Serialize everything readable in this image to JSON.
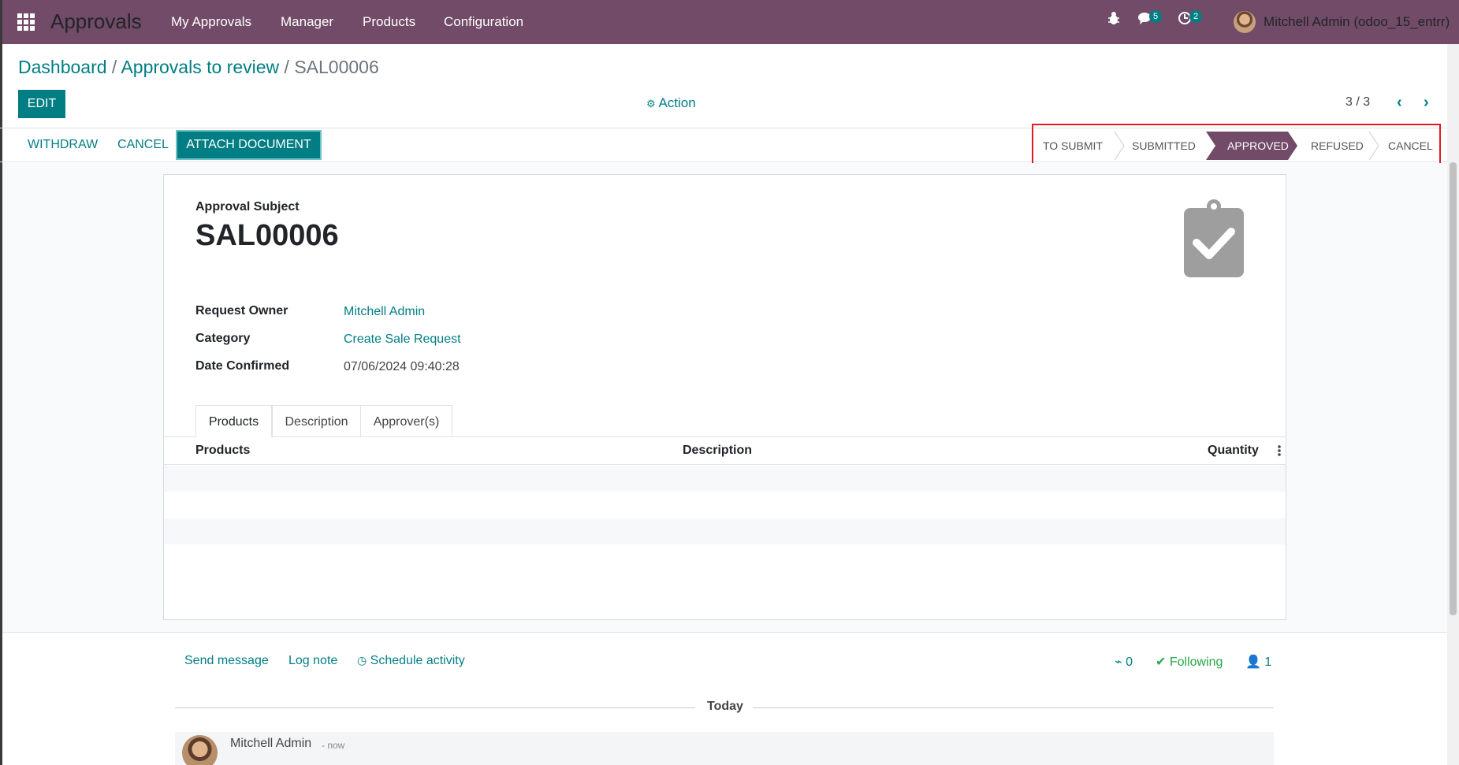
{
  "topbar": {
    "app_name": "Approvals",
    "menu": [
      "My Approvals",
      "Manager",
      "Products",
      "Configuration"
    ],
    "messages_count": "5",
    "activities_count": "2",
    "user": "Mitchell Admin (odoo_15_entrr)"
  },
  "breadcrumb": {
    "dashboard": "Dashboard",
    "sep1": " / ",
    "review": "Approvals to review",
    "sep2": " / ",
    "current": "SAL00006"
  },
  "control": {
    "edit": "EDIT",
    "action": "Action",
    "pager": "3 / 3"
  },
  "statusbar": {
    "withdraw": "WITHDRAW",
    "cancel": "CANCEL",
    "attach": "ATTACH DOCUMENT",
    "stages": [
      "TO SUBMIT",
      "SUBMITTED",
      "APPROVED",
      "REFUSED",
      "CANCEL"
    ],
    "active_stage": "APPROVED"
  },
  "form": {
    "subject_label": "Approval Subject",
    "subject": "SAL00006",
    "fields": [
      {
        "label": "Request Owner",
        "value": "Mitchell Admin"
      },
      {
        "label": "Category",
        "value": "Create Sale Request"
      },
      {
        "label": "Date Confirmed",
        "value": "07/06/2024 09:40:28"
      }
    ],
    "tabs": [
      "Products",
      "Description",
      "Approver(s)"
    ],
    "columns": [
      "Products",
      "Description",
      "Quantity"
    ]
  },
  "chatter": {
    "send_message": "Send message",
    "log_note": "Log note",
    "schedule": "Schedule activity",
    "attachments": "0",
    "following": "Following",
    "followers": "1",
    "today": "Today",
    "author": "Mitchell Admin",
    "time": "- now"
  },
  "colors": {
    "brand": "#714B67",
    "accent": "#017e84",
    "highlight": "#e01b24"
  }
}
